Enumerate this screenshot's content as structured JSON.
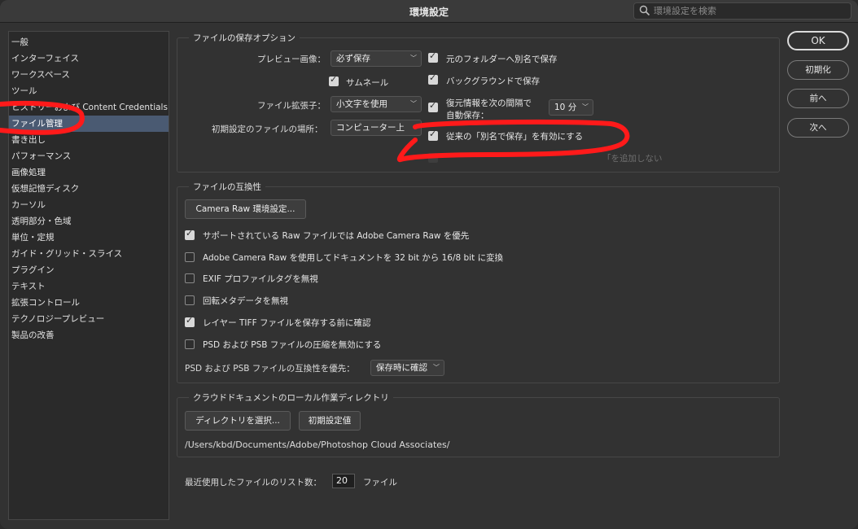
{
  "window": {
    "title": "環境設定"
  },
  "search": {
    "placeholder": "環境設定を検索",
    "icon": "search-icon"
  },
  "sidebar": {
    "items": [
      {
        "label": "一般"
      },
      {
        "label": "インターフェイス"
      },
      {
        "label": "ワークスペース"
      },
      {
        "label": "ツール"
      },
      {
        "label": "ヒストリーおよび Content Credentials"
      },
      {
        "label": "ファイル管理",
        "selected": true
      },
      {
        "label": "書き出し"
      },
      {
        "label": "パフォーマンス"
      },
      {
        "label": "画像処理"
      },
      {
        "label": "仮想記憶ディスク"
      },
      {
        "label": "カーソル"
      },
      {
        "label": "透明部分・色域"
      },
      {
        "label": "単位・定規"
      },
      {
        "label": "ガイド・グリッド・スライス"
      },
      {
        "label": "プラグイン"
      },
      {
        "label": "テキスト"
      },
      {
        "label": "拡張コントロール"
      },
      {
        "label": "テクノロジープレビュー"
      },
      {
        "label": "製品の改善"
      }
    ]
  },
  "save_options": {
    "title": "ファイルの保存オプション",
    "preview_label": "プレビュー画像：",
    "preview_value": "必ず保存",
    "thumbnail_label": "サムネール",
    "thumbnail_checked": true,
    "ext_label": "ファイル拡張子：",
    "ext_value": "小文字を使用",
    "default_location_label": "初期設定のファイルの場所：",
    "default_location_value": "コンピューター上",
    "save_as_original_label": "元のフォルダーへ別名で保存",
    "save_as_original_checked": true,
    "background_save_label": "バックグラウンドで保存",
    "background_save_checked": true,
    "autosave_label_1": "復元情報を次の間隔で",
    "autosave_label_2": "自動保存：",
    "autosave_checked": true,
    "autosave_interval": "10 分",
    "legacy_save_as_label": "従来の「別名で保存」を有効にする",
    "legacy_save_as_checked": true,
    "copy_label": "「を追加しない",
    "copy_checked": false
  },
  "compat": {
    "title": "ファイルの互換性",
    "camera_raw_button": "Camera Raw 環境設定...",
    "options": [
      {
        "label": "サポートされている Raw ファイルでは Adobe Camera Raw を優先",
        "checked": true
      },
      {
        "label": "Adobe Camera Raw を使用してドキュメントを 32 bit から 16/8 bit に変換",
        "checked": false
      },
      {
        "label": "EXIF プロファイルタグを無視",
        "checked": false
      },
      {
        "label": "回転メタデータを無視",
        "checked": false
      },
      {
        "label": "レイヤー TIFF ファイルを保存する前に確認",
        "checked": true
      },
      {
        "label": "PSD および PSB ファイルの圧縮を無効にする",
        "checked": false
      }
    ],
    "maximize_label": "PSD および PSB ファイルの互換性を優先：",
    "maximize_value": "保存時に確認"
  },
  "cloud": {
    "title": "クラウドドキュメントのローカル作業ディレクトリ",
    "choose_button": "ディレクトリを選択...",
    "default_button": "初期設定値",
    "path": "/Users/kbd/Documents/Adobe/Photoshop Cloud Associates/"
  },
  "recent": {
    "label": "最近使用したファイルのリスト数：",
    "value": "20",
    "unit": "ファイル"
  },
  "buttons": {
    "ok": "OK",
    "reset": "初期化",
    "prev": "前へ",
    "next": "次へ"
  },
  "colors": {
    "annotation": "#ff1a1a",
    "selection": "#4a5a72"
  }
}
